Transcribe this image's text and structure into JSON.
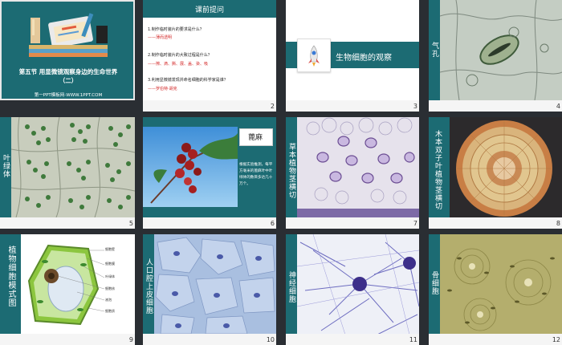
{
  "slides": [
    {
      "num": "1",
      "title": "第五节 用显微镜观察身边的生命世界",
      "subtitle": "（二）",
      "footer": "第一PPT模板网-WWW.1PPT.COM"
    },
    {
      "num": "2",
      "header": "课前提问",
      "q1": "1.制作临时装片的要求是什么？",
      "a1": "——薄而透明",
      "q2": "2.制作临时装片的大致过程是什么？",
      "a2": "——擦、滴、撕、展、盖、染、吸",
      "q3": "3.利用显微镜发现并命名细胞的科学家是谁？",
      "a3": "——罗伯特·胡克"
    },
    {
      "num": "3",
      "title": "生物细胞的观察"
    },
    {
      "num": "4",
      "label": "气孔"
    },
    {
      "num": "5",
      "label": "叶绿体"
    },
    {
      "num": "6",
      "label": "蓖麻",
      "desc": "根据实验推测，每平方毫米的蓖麻叶中叶绿体的数目多达几十万个。"
    },
    {
      "num": "7",
      "label": "草本植物茎横切"
    },
    {
      "num": "8",
      "label": "木本双子叶植物茎横切"
    },
    {
      "num": "9",
      "label": "植物细胞模式图",
      "parts": [
        "细胞壁",
        "细胞膜",
        "叶绿体",
        "细胞核",
        "液泡",
        "细胞质"
      ]
    },
    {
      "num": "10",
      "label": "人口腔上皮细胞"
    },
    {
      "num": "11",
      "label": "神经细胞"
    },
    {
      "num": "12",
      "label": "骨细胞"
    }
  ],
  "colors": {
    "accent": "#1c6b73",
    "answer": "#d42a2a",
    "background": "#2a2e33"
  }
}
